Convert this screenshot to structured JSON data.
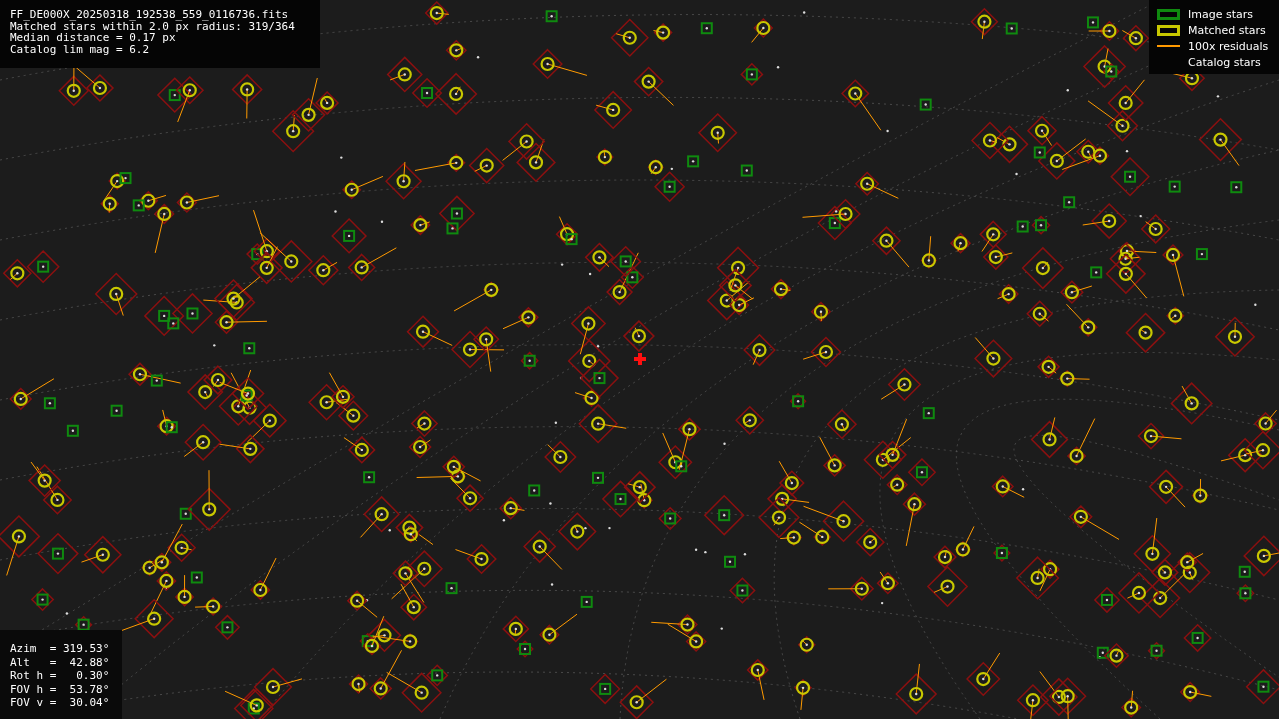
{
  "header": {
    "lines": [
      "FF_DE000X_20250318_192538_559_0116736.fits",
      "Matched stars within 2.0 px radius: 319/364",
      "Median distance = 0.17 px",
      "Catalog lim mag = 6.2"
    ]
  },
  "legend": [
    {
      "label": "Image stars",
      "kind": "box",
      "color": "#0f8a0f"
    },
    {
      "label": "Matched stars",
      "kind": "box",
      "color": "#c8c800"
    },
    {
      "label": "100x residuals",
      "kind": "line",
      "color": "#ff9a00"
    },
    {
      "label": "Catalog stars",
      "kind": "none"
    }
  ],
  "pointing": {
    "lines": [
      "Azim  = 319.53°",
      "Alt   =  42.88°",
      "Rot h =   0.30°",
      "FOV h =  53.78°",
      "FOV v =  30.04°"
    ]
  }
}
